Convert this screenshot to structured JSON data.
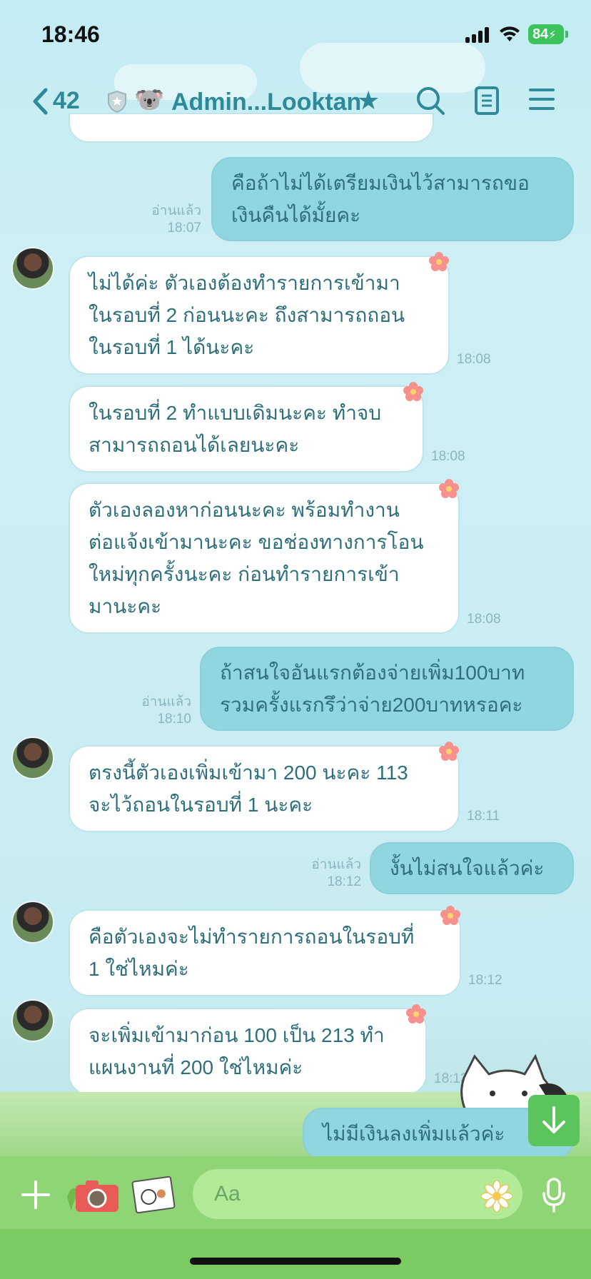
{
  "status_bar": {
    "time": "18:46",
    "battery": "84"
  },
  "header": {
    "back_count": "42",
    "title": "Admin...Looktan"
  },
  "messages": [
    {
      "side": "out",
      "text_lines": [
        "คือถ้าไม่ได้เตรียมเงินไว้สามารถขอ",
        "เงินคืนได้มั้ยคะ"
      ],
      "read": "อ่านแล้ว",
      "time": "18:07"
    },
    {
      "side": "in",
      "text_lines": [
        "ไม่ได้ค่ะ ตัวเองต้องทำรายการเข้ามา",
        "ในรอบที่ 2 ก่อนนะคะ ถึงสามารถถอน",
        "ในรอบที่ 1 ได้นะคะ"
      ],
      "time": "18:08"
    },
    {
      "side": "in",
      "text_lines": [
        "ในรอบที่ 2 ทำแบบเดิมนะคะ ทำจบ",
        "สามารถถอนได้เลยนะคะ"
      ],
      "time": "18:08"
    },
    {
      "side": "in",
      "text_lines": [
        "ตัวเองลองหาก่อนนะคะ พร้อมทำงาน",
        "ต่อแจ้งเข้ามานะคะ ขอช่องทางการโอน",
        "ใหม่ทุกครั้งนะคะ ก่อนทำรายการเข้า",
        "มานะคะ"
      ],
      "time": "18:08"
    },
    {
      "side": "out",
      "text_lines": [
        "ถ้าสนใจอันแรกต้องจ่ายเพิ่ม100บาท",
        "รวมครั้งแรกรึว่าจ่าย200บาทหรอคะ"
      ],
      "read": "อ่านแล้ว",
      "time": "18:10"
    },
    {
      "side": "in",
      "text_lines": [
        "ตรงนี้ตัวเองเพิ่มเข้ามา 200 นะคะ 113",
        "จะไว้ถอนในรอบที่ 1 นะคะ"
      ],
      "time": "18:11"
    },
    {
      "side": "out",
      "text_lines": [
        "งั้นไม่สนใจแล้วค่ะ"
      ],
      "read": "อ่านแล้ว",
      "time": "18:12"
    },
    {
      "side": "in",
      "text_lines": [
        "คือตัวเองจะไม่ทำรายการถอนในรอบที่",
        "1 ใช่ไหมค่ะ"
      ],
      "time": "18:12"
    },
    {
      "side": "in",
      "text_lines": [
        "จะเพิ่มเข้ามาก่อน 100 เป็น 213 ทำ",
        "แผนงานที่ 200 ใช่ไหมค่ะ"
      ],
      "time": "18:13"
    },
    {
      "side": "out",
      "text_lines": [
        "ไม่มีเงินลงเพิ่มแล้วค่ะ"
      ]
    }
  ],
  "input": {
    "placeholder": "Aa"
  },
  "colors": {
    "accent": "#2e8a98",
    "bubble_out": "#8fd6de",
    "bubble_in": "#ffffff",
    "bar": "#8fd475"
  }
}
